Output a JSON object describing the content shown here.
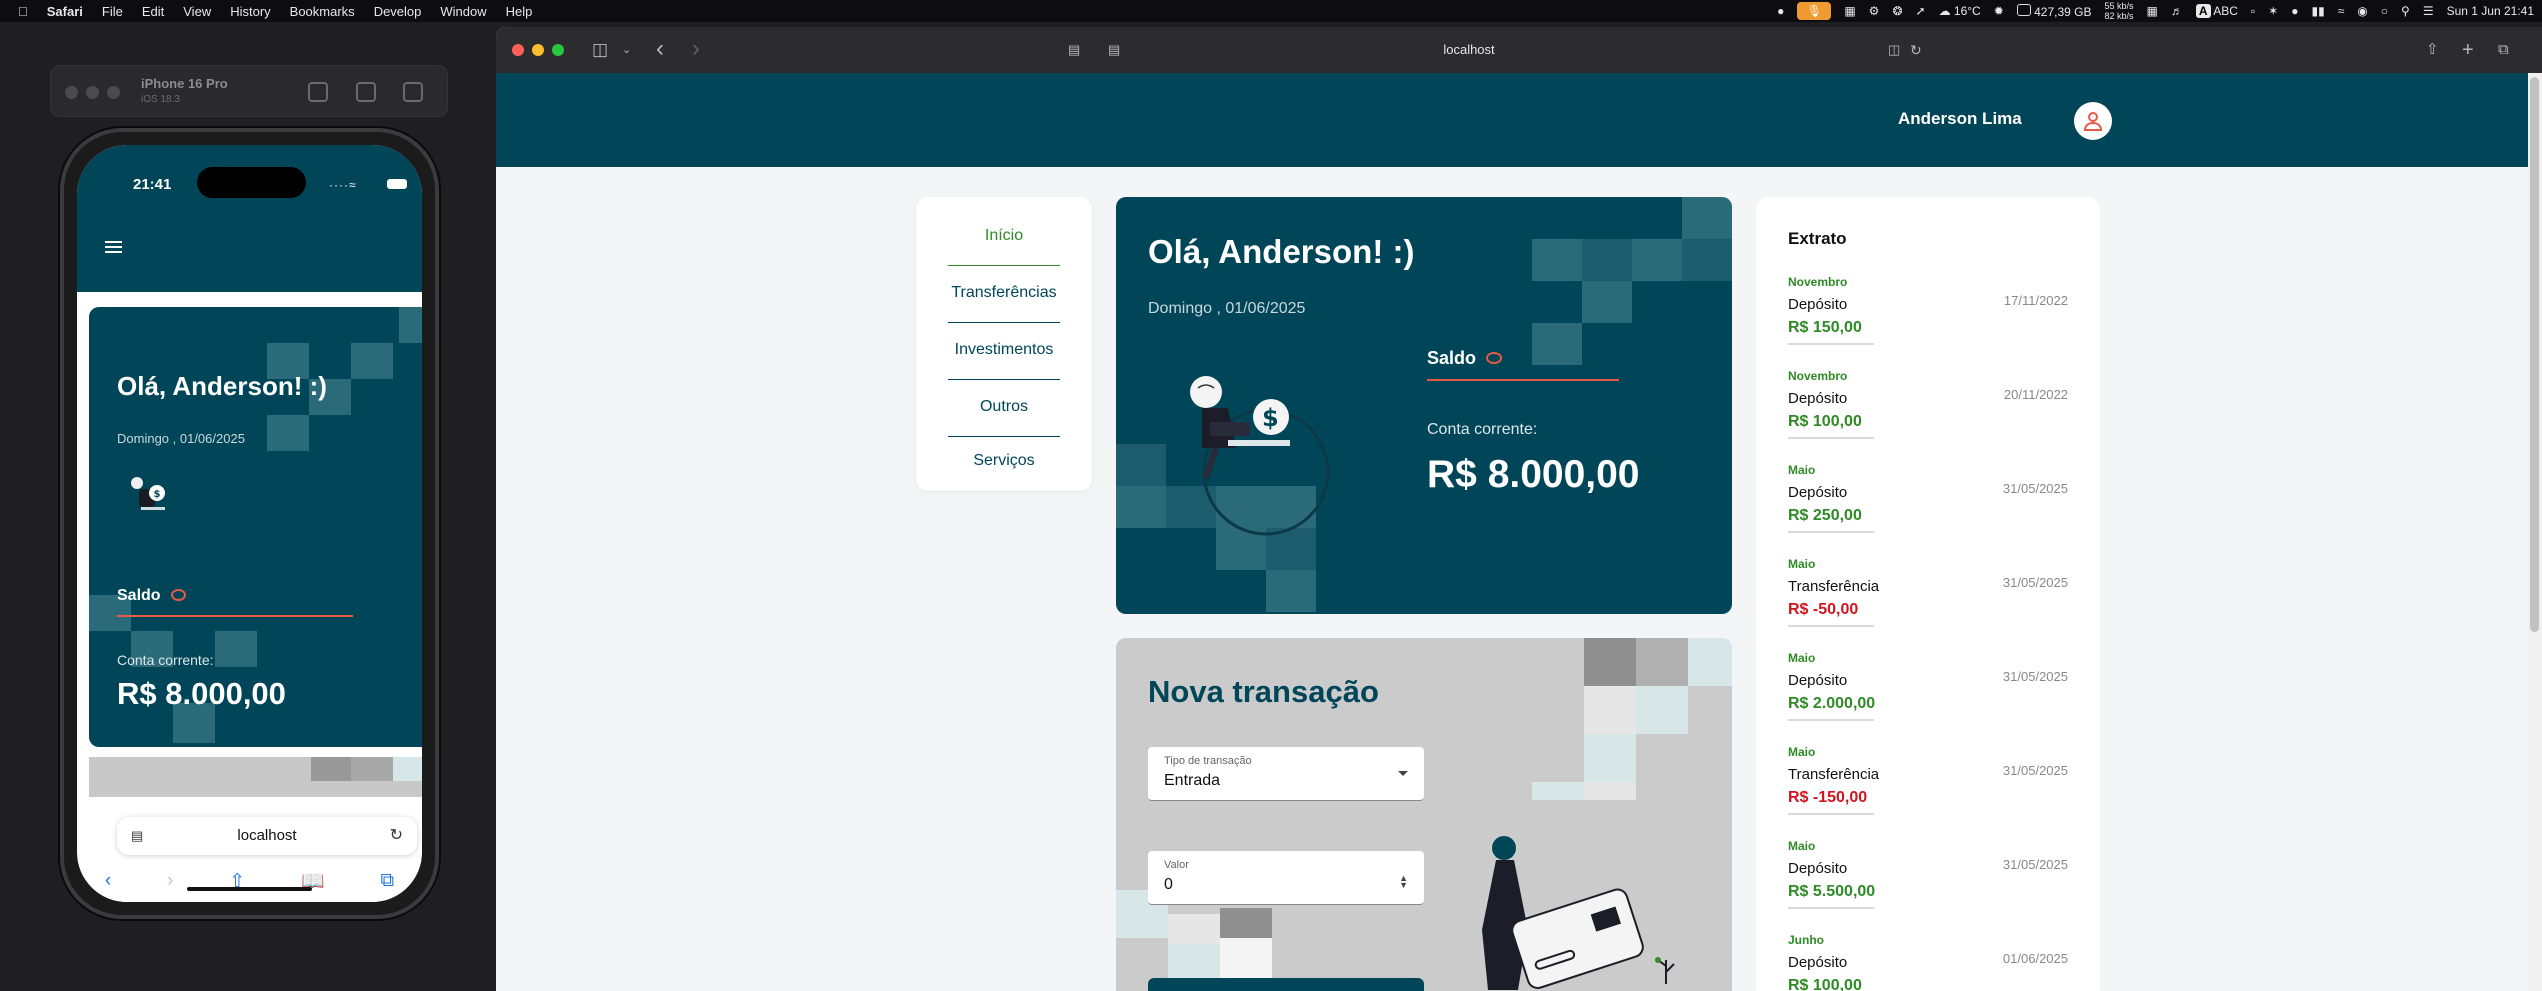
{
  "menubar": {
    "app": "Safari",
    "items": [
      "File",
      "Edit",
      "View",
      "History",
      "Bookmarks",
      "Develop",
      "Window",
      "Help"
    ],
    "weather": "16°C",
    "storage": "427,39 GB",
    "net_up": "55 kb/s",
    "net_down": "82 kb/s",
    "input_source": "ABC",
    "clock": "Sun 1 Jun  21:41"
  },
  "simulator": {
    "device": "iPhone 16 Pro",
    "os": "iOS 18.3",
    "status_time": "21:41",
    "greeting": "Olá, Anderson! :)",
    "date": "Domingo , 01/06/2025",
    "saldo_label": "Saldo",
    "conta_label": "Conta corrente:",
    "balance": "R$ 8.000,00",
    "url": "localhost"
  },
  "browser": {
    "url": "localhost"
  },
  "header": {
    "user_name": "Anderson Lima"
  },
  "nav": {
    "items": [
      {
        "label": "Início",
        "active": true
      },
      {
        "label": "Transferências",
        "active": false
      },
      {
        "label": "Investimentos",
        "active": false
      },
      {
        "label": "Outros Serviços",
        "active": false
      }
    ]
  },
  "account": {
    "greeting": "Olá, Anderson! :)",
    "date": "Domingo , 01/06/2025",
    "saldo_label": "Saldo",
    "conta_label": "Conta corrente:",
    "balance": "R$ 8.000,00"
  },
  "transaction": {
    "title": "Nova transação",
    "type_label": "Tipo de transação",
    "type_value": "Entrada",
    "value_label": "Valor",
    "value_value": "0"
  },
  "statement": {
    "title": "Extrato",
    "entries": [
      {
        "month": "Novembro",
        "type": "Depósito",
        "date": "17/11/2022",
        "amount": "R$ 150,00",
        "negative": false
      },
      {
        "month": "Novembro",
        "type": "Depósito",
        "date": "20/11/2022",
        "amount": "R$ 100,00",
        "negative": false
      },
      {
        "month": "Maio",
        "type": "Depósito",
        "date": "31/05/2025",
        "amount": "R$ 250,00",
        "negative": false
      },
      {
        "month": "Maio",
        "type": "Transferência",
        "date": "31/05/2025",
        "amount": "R$ -50,00",
        "negative": true
      },
      {
        "month": "Maio",
        "type": "Depósito",
        "date": "31/05/2025",
        "amount": "R$ 2.000,00",
        "negative": false
      },
      {
        "month": "Maio",
        "type": "Transferência",
        "date": "31/05/2025",
        "amount": "R$ -150,00",
        "negative": true
      },
      {
        "month": "Maio",
        "type": "Depósito",
        "date": "31/05/2025",
        "amount": "R$ 5.500,00",
        "negative": false
      },
      {
        "month": "Junho",
        "type": "Depósito",
        "date": "01/06/2025",
        "amount": "R$ 100,00",
        "negative": false
      }
    ]
  },
  "colors": {
    "primary": "#014658",
    "accent_red": "#e55a45",
    "positive": "#2e8b25",
    "negative": "#d0151e",
    "page_bg": "#f3f5f6"
  }
}
